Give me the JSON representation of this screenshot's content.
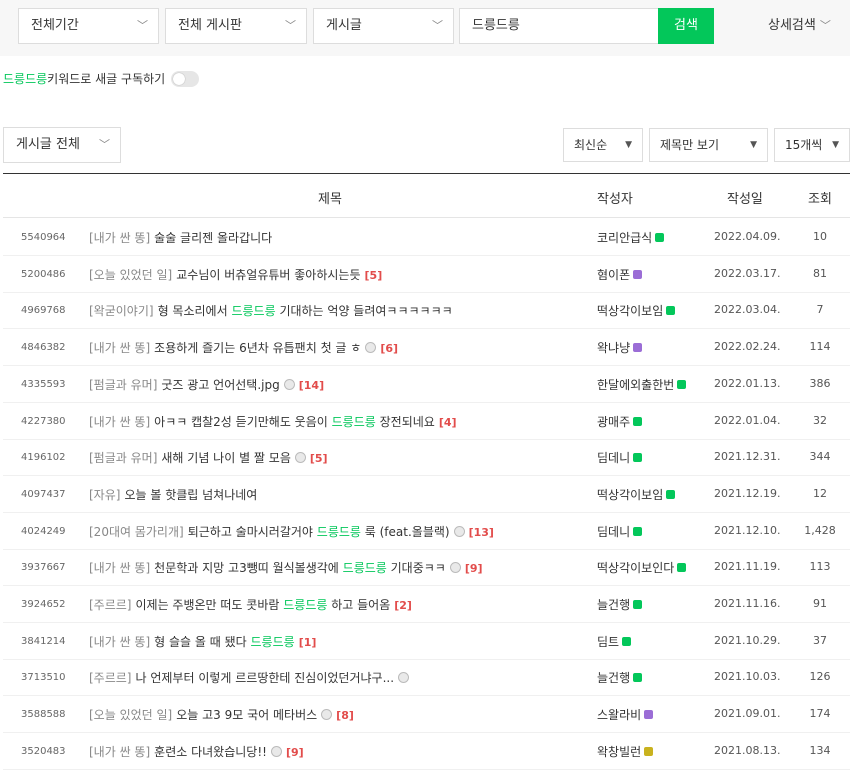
{
  "search": {
    "period": "전체기간",
    "board": "전체 게시판",
    "type": "게시글",
    "query": "드릉드릉",
    "button": "검색",
    "advanced": "상세검색"
  },
  "subscribe": {
    "keyword": "드릉드릉",
    "text": " 키워드로 새글 구독하기"
  },
  "filters": {
    "list": "게시글 전체",
    "sort": "최신순",
    "view": "제목만 보기",
    "count": "15개씩"
  },
  "table": {
    "headers": {
      "title": "제목",
      "author": "작성자",
      "date": "작성일",
      "views": "조회"
    },
    "rows": [
      {
        "num": "5540964",
        "cat": "[내가 싼 똥]",
        "pre": "술술 글리젠 올라갑니다",
        "hl": "",
        "post": "",
        "pic": false,
        "cmt": "",
        "author": "코리안급식",
        "badge": "#03c75a",
        "date": "2022.04.09.",
        "views": "10"
      },
      {
        "num": "5200486",
        "cat": "[오늘 있었던 일]",
        "pre": "교수님이 버츄얼유튜버 좋아하시는듯",
        "hl": "",
        "post": "",
        "pic": false,
        "cmt": "[5]",
        "author": "혐이폰",
        "badge": "#9b6dd6",
        "date": "2022.03.17.",
        "views": "81"
      },
      {
        "num": "4969768",
        "cat": "[왁굳이야기]",
        "pre": "형 목소리에서 ",
        "hl": "드릉드릉",
        "post": " 기대하는 억양 들려여ㅋㅋㅋㅋㅋㅋ",
        "pic": false,
        "cmt": "",
        "author": "떡상각이보임",
        "badge": "#03c75a",
        "date": "2022.03.04.",
        "views": "7"
      },
      {
        "num": "4846382",
        "cat": "[내가 싼 똥]",
        "pre": "조용하게 즐기는 6년차 유틉팬치 첫 글 ㅎ",
        "hl": "",
        "post": "",
        "pic": true,
        "cmt": "[6]",
        "author": "왁냐냥",
        "badge": "#9b6dd6",
        "date": "2022.02.24.",
        "views": "114"
      },
      {
        "num": "4335593",
        "cat": "[펌글과 유머]",
        "pre": "굿즈 광고 언어선택.jpg",
        "hl": "",
        "post": "",
        "pic": true,
        "cmt": "[14]",
        "author": "한달에외출한번",
        "badge": "#03c75a",
        "date": "2022.01.13.",
        "views": "386"
      },
      {
        "num": "4227380",
        "cat": "[내가 싼 똥]",
        "pre": "아ㅋㅋ 캡찰2성 듣기만해도 웃음이 ",
        "hl": "드릉드릉",
        "post": " 장전되네요",
        "pic": false,
        "cmt": "[4]",
        "author": "광매주",
        "badge": "#03c75a",
        "date": "2022.01.04.",
        "views": "32"
      },
      {
        "num": "4196102",
        "cat": "[펌글과 유머]",
        "pre": "새해 기념 나이 별 짤 모음",
        "hl": "",
        "post": "",
        "pic": true,
        "cmt": "[5]",
        "author": "딤데니",
        "badge": "#03c75a",
        "date": "2021.12.31.",
        "views": "344"
      },
      {
        "num": "4097437",
        "cat": "[자유]",
        "pre": "오늘 볼 핫클립 넘쳐나네여",
        "hl": "",
        "post": "",
        "pic": false,
        "cmt": "",
        "author": "떡상각이보임",
        "badge": "#03c75a",
        "date": "2021.12.19.",
        "views": "12"
      },
      {
        "num": "4024249",
        "cat": "[20대여 몸가리개]",
        "pre": "퇴근하고 술마시러갈거야 ",
        "hl": "드릉드릉",
        "post": " 룩 (feat.올블랙)",
        "pic": true,
        "cmt": "[13]",
        "author": "딤데니",
        "badge": "#03c75a",
        "date": "2021.12.10.",
        "views": "1,428"
      },
      {
        "num": "3937667",
        "cat": "[내가 싼 똥]",
        "pre": "천문학과 지망 고3뺑띠 월식볼생각에 ",
        "hl": "드릉드릉",
        "post": " 기대중ㅋㅋ",
        "pic": true,
        "cmt": "[9]",
        "author": "떡상각이보인다",
        "badge": "#03c75a",
        "date": "2021.11.19.",
        "views": "113"
      },
      {
        "num": "3924652",
        "cat": "[주르르]",
        "pre": "이제는 주뱅온만 떠도 콧바람 ",
        "hl": "드릉드릉",
        "post": " 하고 들어옴",
        "pic": false,
        "cmt": "[2]",
        "author": "늘건행",
        "badge": "#03c75a",
        "date": "2021.11.16.",
        "views": "91"
      },
      {
        "num": "3841214",
        "cat": "[내가 싼 똥]",
        "pre": "형 슬슬 올 때 됐다 ",
        "hl": "드릉드릉",
        "post": "",
        "pic": false,
        "cmt": "[1]",
        "author": "딤트",
        "badge": "#03c75a",
        "date": "2021.10.29.",
        "views": "37"
      },
      {
        "num": "3713510",
        "cat": "[주르르]",
        "pre": "나 언제부터 이렇게 르르땅한테 진심이었던거냐구...",
        "hl": "",
        "post": "",
        "pic": true,
        "cmt": "",
        "author": "늘건행",
        "badge": "#03c75a",
        "date": "2021.10.03.",
        "views": "126"
      },
      {
        "num": "3588588",
        "cat": "[오늘 있었던 일]",
        "pre": "오늘 고3 9모 국어 메타버스",
        "hl": "",
        "post": "",
        "pic": true,
        "cmt": "[8]",
        "author": "스왈라비",
        "badge": "#9b6dd6",
        "date": "2021.09.01.",
        "views": "174"
      },
      {
        "num": "3520483",
        "cat": "[내가 싼 똥]",
        "pre": "훈련소 다녀왔습니당!!",
        "hl": "",
        "post": "",
        "pic": true,
        "cmt": "[9]",
        "author": "왁창빌런",
        "badge": "#c9b21e",
        "date": "2021.08.13.",
        "views": "134"
      }
    ]
  }
}
